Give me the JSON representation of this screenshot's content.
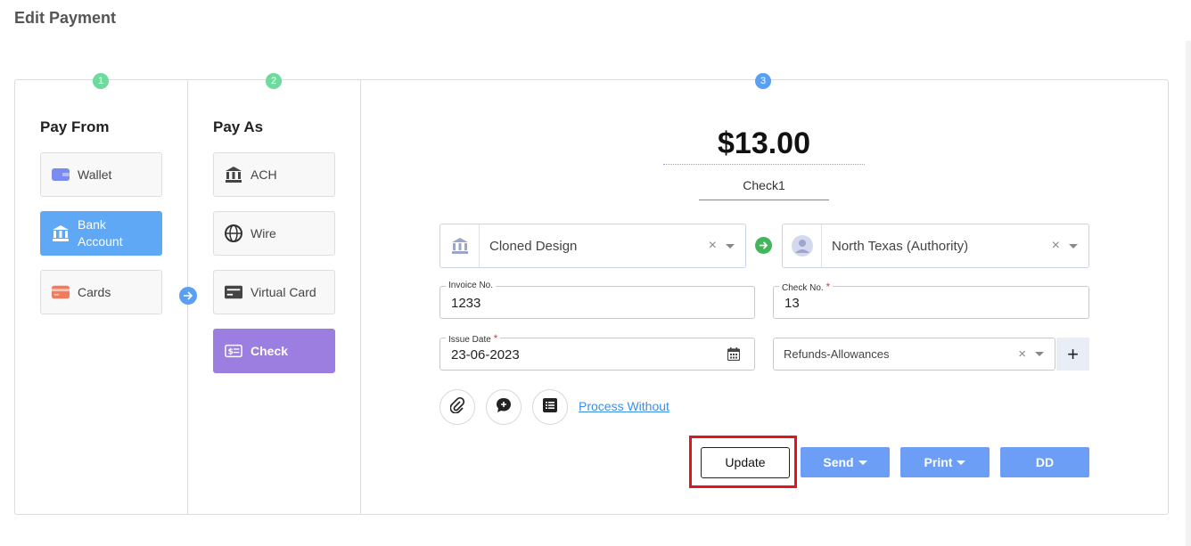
{
  "page": {
    "title": "Edit Payment"
  },
  "steps": [
    "1",
    "2",
    "3"
  ],
  "pay_from": {
    "heading": "Pay From",
    "options": [
      {
        "label": "Wallet",
        "icon": "wallet-icon",
        "selected": false
      },
      {
        "label_line1": "Bank",
        "label_line2": "Account",
        "icon": "bank-icon",
        "selected": true
      },
      {
        "label": "Cards",
        "icon": "credit-card-icon",
        "selected": false
      }
    ]
  },
  "pay_as": {
    "heading": "Pay As",
    "options": [
      {
        "label": "ACH",
        "icon": "bank-icon",
        "selected": false
      },
      {
        "label": "Wire",
        "icon": "globe-icon",
        "selected": false
      },
      {
        "label": "Virtual Card",
        "icon": "card-icon",
        "selected": false
      },
      {
        "label": "Check",
        "icon": "check-icon",
        "selected": true
      }
    ]
  },
  "payment": {
    "amount": "$13.00",
    "check_name": "Check1",
    "from_account": "Cloned Design",
    "to_payee": "North Texas (Authority)",
    "invoice_label": "Invoice No.",
    "invoice_value": "1233",
    "check_no_label": "Check No.",
    "check_no_value": "13",
    "issue_date_label": "Issue Date",
    "issue_date_value": "23-06-2023",
    "category": "Refunds-Allowances",
    "required_mark": "*",
    "clear_symbol": "×",
    "add_symbol": "+"
  },
  "actions": {
    "process_without": "Process Without",
    "update": "Update",
    "send": "Send",
    "print": "Print",
    "dd": "DD"
  },
  "colors": {
    "accent_blue": "#5fa8f5",
    "accent_purple": "#9b7ee0",
    "button_blue": "#6d9ef5",
    "highlight_red": "#e0161f",
    "step_green": "#6edb9c"
  }
}
